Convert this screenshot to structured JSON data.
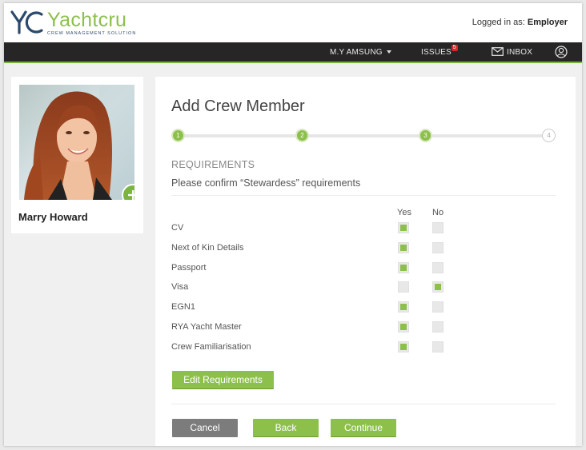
{
  "brand": {
    "name": "Yachtcru",
    "tagline": "CREW MANAGEMENT SOLUTION",
    "primary_color": "#8dc04a",
    "navy_color": "#2c4a6b"
  },
  "login": {
    "prefix": "Logged in as:",
    "role": "Employer"
  },
  "nav": {
    "vessel": "M.Y AMSUNG",
    "issues_label": "ISSUES",
    "issues_count": "5",
    "inbox_label": "INBOX"
  },
  "profile": {
    "name": "Marry Howard"
  },
  "page": {
    "title": "Add Crew Member",
    "steps": [
      "1",
      "2",
      "3",
      "4"
    ],
    "current_step": 3,
    "section_label": "REQUIREMENTS",
    "confirm_text": "Please confirm “Stewardess” requirements"
  },
  "requirements": {
    "columns": {
      "yes": "Yes",
      "no": "No"
    },
    "items": [
      {
        "label": "CV",
        "answer": "yes"
      },
      {
        "label": "Next of Kin Details",
        "answer": "yes"
      },
      {
        "label": "Passport",
        "answer": "yes"
      },
      {
        "label": "Visa",
        "answer": "no"
      },
      {
        "label": "EGN1",
        "answer": "yes"
      },
      {
        "label": "RYA Yacht Master",
        "answer": "yes"
      },
      {
        "label": "Crew Familiarisation",
        "answer": "yes"
      }
    ],
    "edit_button": "Edit Requirements"
  },
  "actions": {
    "cancel": "Cancel",
    "back": "Back",
    "continue": "Continue"
  }
}
